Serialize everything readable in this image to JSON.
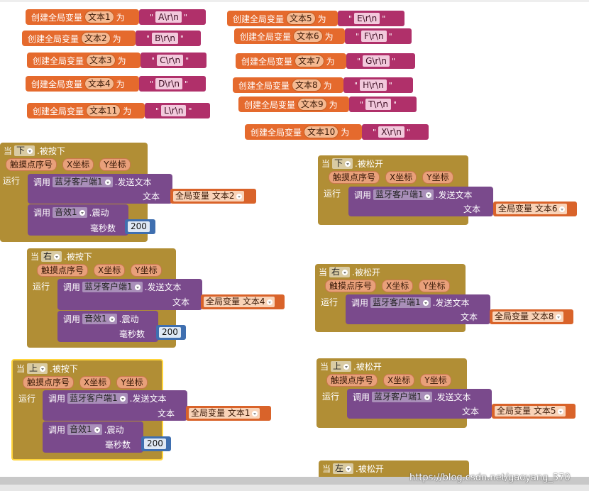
{
  "global_vars": {
    "create_label": "创建全局变量",
    "as_label": "为",
    "quote": "\"",
    "items": [
      {
        "name": "文本1",
        "value": "A\\r\\n"
      },
      {
        "name": "文本2",
        "value": "B\\r\\n"
      },
      {
        "name": "文本3",
        "value": "C\\r\\n"
      },
      {
        "name": "文本4",
        "value": "D\\r\\n"
      },
      {
        "name": "文本11",
        "value": "L\\r\\n"
      },
      {
        "name": "文本5",
        "value": "E\\r\\n"
      },
      {
        "name": "文本6",
        "value": "F\\r\\n"
      },
      {
        "name": "文本7",
        "value": "G\\r\\n"
      },
      {
        "name": "文本8",
        "value": "H\\r\\n"
      },
      {
        "name": "文本9",
        "value": "T\\r\\n"
      },
      {
        "name": "文本10",
        "value": "X\\r\\n"
      }
    ]
  },
  "labels": {
    "when": "当",
    "pressed": ".被按下",
    "released": ".被松开",
    "touch_index": "触摸点序号",
    "x_coord": "X坐标",
    "y_coord": "Y坐标",
    "run": "运行",
    "call": "调用",
    "bt_client": "蓝牙客户端1",
    "send_text": ".发送文本",
    "text": "文本",
    "sound": "音效1",
    "vibrate": ".震动",
    "millis": "毫秒数",
    "global_var_prefix": "全局变量"
  },
  "events": [
    {
      "button": "下",
      "type": "pressed",
      "var": "文本2",
      "ms": "200"
    },
    {
      "button": "下",
      "type": "released",
      "var": "文本6"
    },
    {
      "button": "右",
      "type": "pressed",
      "var": "文本4",
      "ms": "200"
    },
    {
      "button": "右",
      "type": "released",
      "var": "文本8"
    },
    {
      "button": "上",
      "type": "pressed",
      "var": "文本1",
      "ms": "200"
    },
    {
      "button": "上",
      "type": "released",
      "var": "文本5"
    },
    {
      "button": "左",
      "type": "released"
    }
  ],
  "watermark": "https://blog.csdn.net/gaoyang_570",
  "colors": {
    "variable_orange": "#e56a2d",
    "string_magenta": "#b0306a",
    "event_gold": "#b18e35",
    "procedure_purple": "#7a4a8c",
    "number_blue": "#3f6fb0",
    "selected_outline": "#ffd43a"
  }
}
